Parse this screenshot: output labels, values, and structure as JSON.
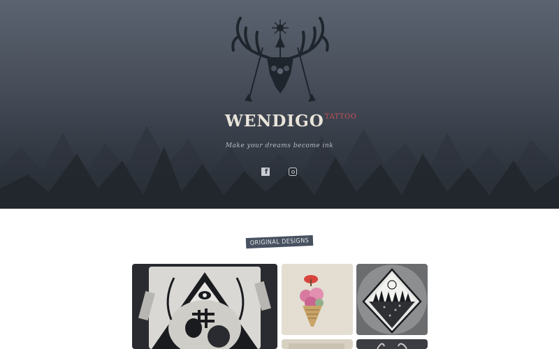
{
  "brand": {
    "name": "WENDIGO",
    "suffix": "TATTOO",
    "tagline": "Make your dreams become ink"
  },
  "social": {
    "facebook_icon": "facebook-icon",
    "instagram_icon": "instagram-icon"
  },
  "section": {
    "title": "ORIGINAL DESIGNS"
  },
  "gallery": {
    "items": [
      {
        "icon": "skull-pyramid-artwork"
      },
      {
        "icon": "icecream-flowers-artwork"
      },
      {
        "icon": "diamond-landscape-artwork"
      },
      {
        "icon": "artwork-thumbnail"
      },
      {
        "icon": "artwork-thumbnail"
      }
    ]
  },
  "colors": {
    "accent": "#c6505a",
    "tag_background": "#475160"
  }
}
